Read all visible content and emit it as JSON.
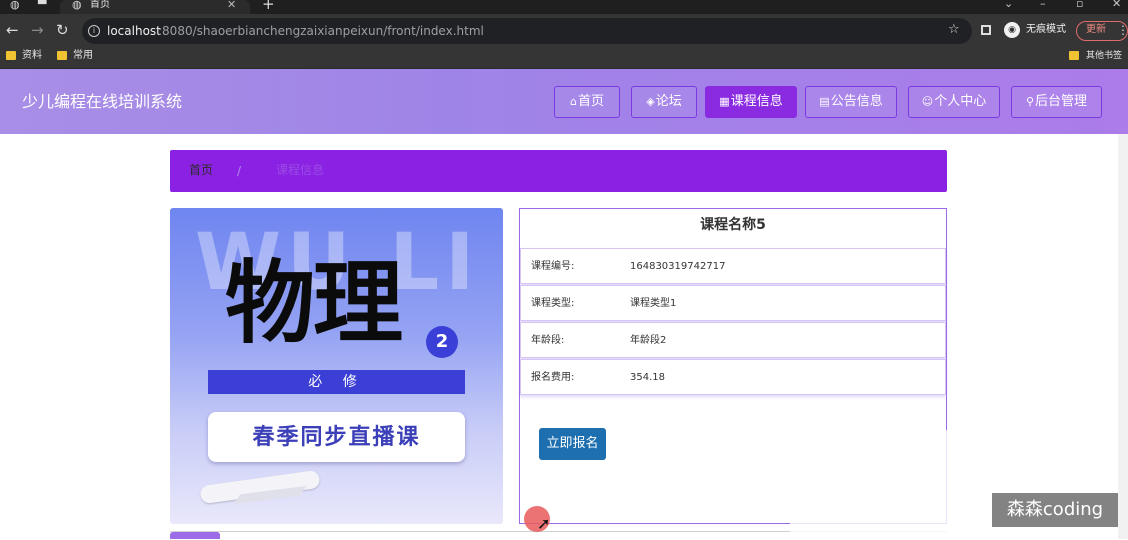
{
  "browser": {
    "tab_title": "首页",
    "url_host": "localhost",
    "url_path": ":8080/shaoerbianchengzaixianpeixun/front/index.html",
    "incognito_label": "无痕模式",
    "update_label": "更新",
    "bookmarks": [
      "资料",
      "常用"
    ],
    "other_bookmarks": "其他书签"
  },
  "site": {
    "title": "少儿编程在线培训系统",
    "nav": [
      {
        "icon": "⌂",
        "label": "首页"
      },
      {
        "icon": "◈",
        "label": "论坛"
      },
      {
        "icon": "▦",
        "label": "课程信息"
      },
      {
        "icon": "▤",
        "label": "公告信息"
      },
      {
        "icon": "☺",
        "label": "个人中心"
      },
      {
        "icon": "⚲",
        "label": "后台管理"
      }
    ]
  },
  "breadcrumb": {
    "home": "首页",
    "separator": "/",
    "current": "课程信息"
  },
  "poster": {
    "bg_text": "WU LI",
    "title": "物理",
    "badge": "2",
    "band": "必 修",
    "pill": "春季同步直播课"
  },
  "course": {
    "name": "课程名称5",
    "fields": [
      {
        "label": "课程编号:",
        "value": "164830319742717"
      },
      {
        "label": "课程类型:",
        "value": "课程类型1"
      },
      {
        "label": "年龄段:",
        "value": "年龄段2"
      },
      {
        "label": "报名费用:",
        "value": "354.18"
      }
    ],
    "signup_label": "立即报名"
  },
  "watermark": "森森coding",
  "colors": {
    "header": "#a88ee6",
    "accent": "#8a2be2",
    "button": "#1e6fb0"
  }
}
